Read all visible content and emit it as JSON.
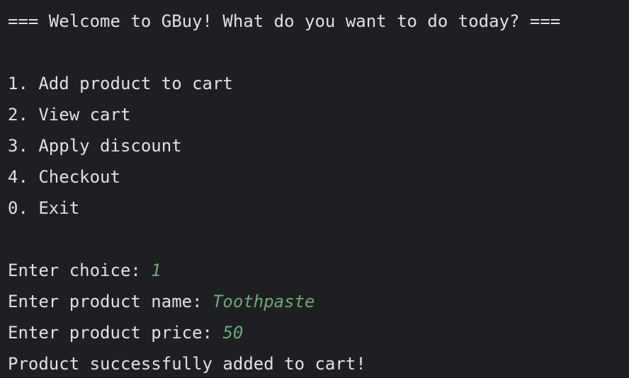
{
  "console": {
    "header": "=== Welcome to GBuy! What do you want to do today? ===",
    "menu": [
      "1. Add product to cart",
      "2. View cart",
      "3. Apply discount",
      "4. Checkout",
      "0. Exit"
    ],
    "prompts": [
      {
        "label": "Enter choice: ",
        "value": "1"
      },
      {
        "label": "Enter product name: ",
        "value": "Toothpaste"
      },
      {
        "label": "Enter product price: ",
        "value": "50"
      }
    ],
    "result": "Product successfully added to cart!",
    "colors": {
      "background": "#1e1f22",
      "text": "#dfe1e5",
      "user_input": "#6aab73"
    }
  }
}
